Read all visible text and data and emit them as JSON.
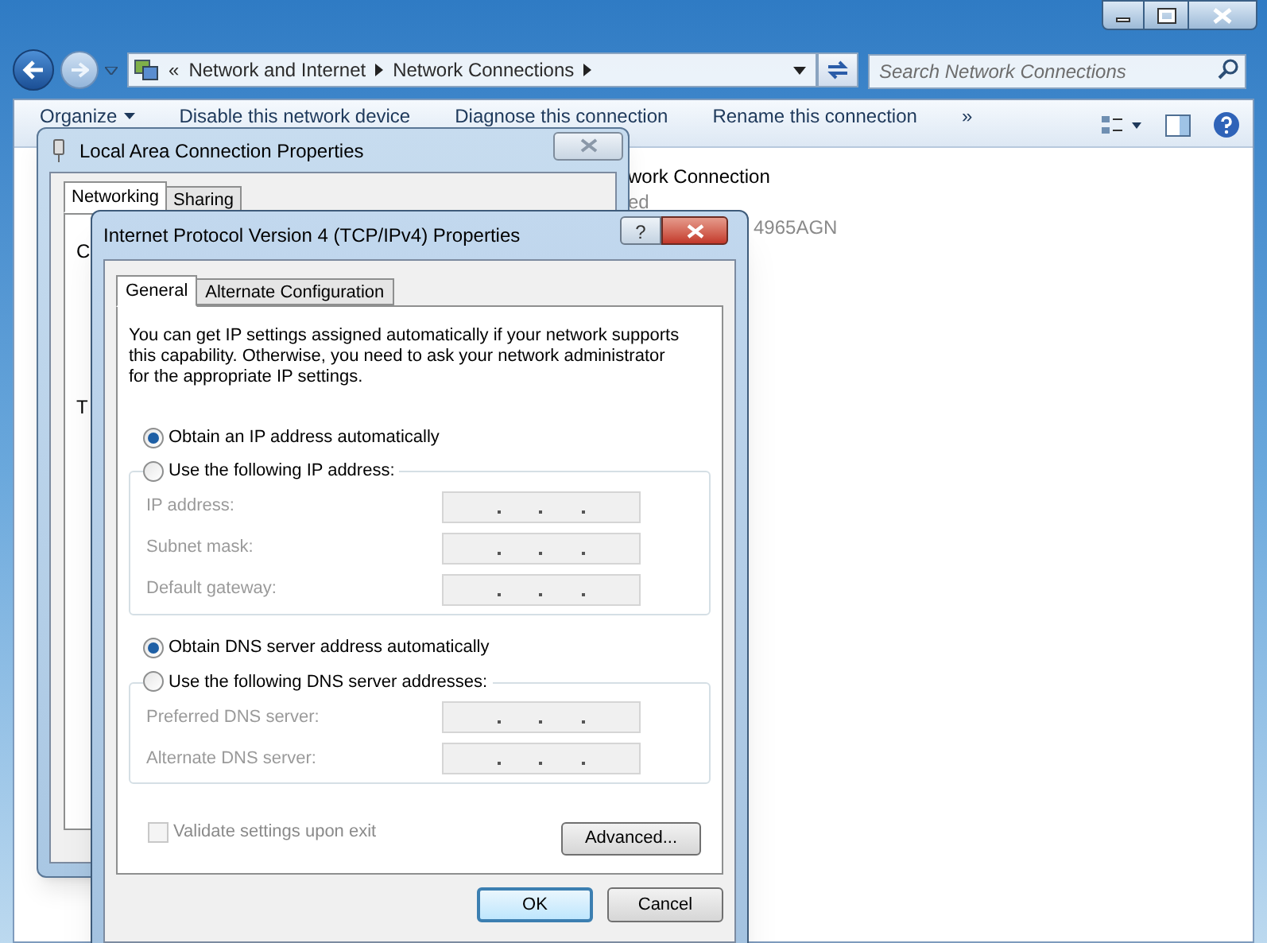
{
  "explorer": {
    "breadcrumb": [
      "«",
      "Network and Internet",
      "Network Connections"
    ],
    "search": {
      "placeholder": "Search Network Connections"
    },
    "toolbar": [
      "Organize",
      "Disable this network device",
      "Diagnose this connection",
      "Rename this connection",
      "»"
    ],
    "content_texts": [
      "work Connection",
      "ed",
      "4965AGN"
    ]
  },
  "lan_dialog": {
    "title": "Local Area Connection Properties",
    "tabs": [
      {
        "label": "Networking",
        "selected": true
      },
      {
        "label": "Sharing",
        "selected": false
      }
    ],
    "partial_labels": [
      "C",
      "T"
    ]
  },
  "ipv4_dialog": {
    "title": "Internet Protocol Version 4 (TCP/IPv4) Properties",
    "help_button": "?",
    "tabs": [
      {
        "label": "General",
        "selected": true
      },
      {
        "label": "Alternate Configuration",
        "selected": false
      }
    ],
    "description": "You can get IP settings assigned automatically if your network supports this capability. Otherwise, you need to ask your network administrator for the appropriate IP settings.",
    "ip_section": {
      "options": [
        {
          "label": "Obtain an IP address automatically",
          "selected": true
        },
        {
          "label": "Use the following IP address:",
          "selected": false
        }
      ],
      "fields": [
        {
          "label": "IP address:",
          "disabled": true
        },
        {
          "label": "Subnet mask:",
          "disabled": true
        },
        {
          "label": "Default gateway:",
          "disabled": true
        }
      ]
    },
    "dns_section": {
      "options": [
        {
          "label": "Obtain DNS server address automatically",
          "selected": true
        },
        {
          "label": "Use the following DNS server addresses:",
          "selected": false
        }
      ],
      "fields": [
        {
          "label": "Preferred DNS server:",
          "disabled": true
        },
        {
          "label": "Alternate DNS server:",
          "disabled": true
        }
      ]
    },
    "validate": {
      "label": "Validate settings upon exit",
      "checked": false,
      "disabled": true
    },
    "advanced_button": "Advanced...",
    "buttons": [
      {
        "label": "OK",
        "default": true
      },
      {
        "label": "Cancel",
        "default": false
      }
    ]
  }
}
